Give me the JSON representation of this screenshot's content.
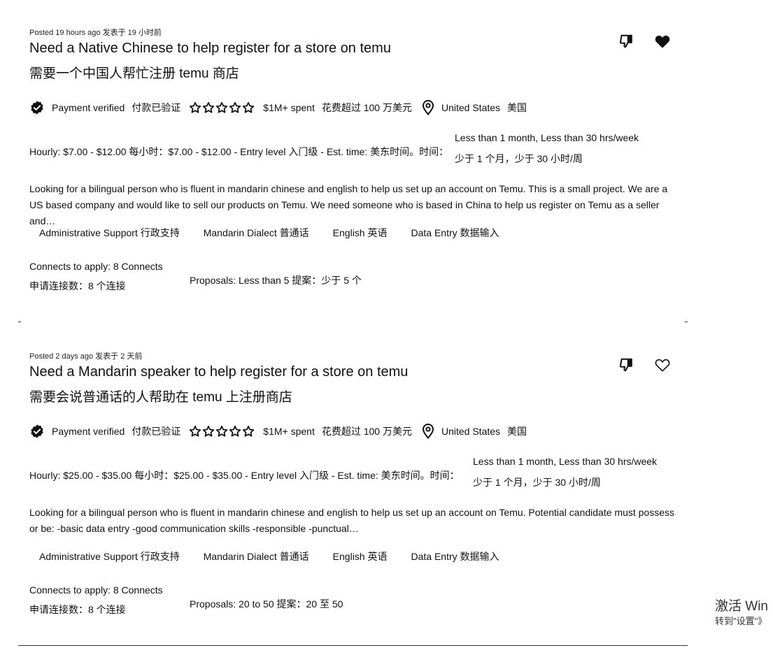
{
  "jobs": [
    {
      "posted": "Posted 19 hours ago 发表于 19 小时前",
      "title_en": "Need a Native Chinese to help register for a store on temu",
      "title_zh": "需要一个中国人帮忙注册 temu 商店",
      "payment_verified": "Payment verified",
      "payment_verified_zh": "付款已验证",
      "rating_stars": 5,
      "spent": "$1M+  spent",
      "spent_zh": "花费超过 100 万美元",
      "location": "United States",
      "location_zh": "美国",
      "hourly": "Hourly: $7.00 - $12.00  每小时：$7.00 - $12.00 - Entry level 入门级 - Est. time: 美东时间。时间：",
      "duration": "Less than 1 month, Less than 30 hrs/week",
      "duration_zh": "少于 1 个月，少于 30 小时/周",
      "description": "Looking for a bilingual person who is fluent in mandarin chinese and english to help us set up an account on Temu. This is a small project. We are a US based company and would like to sell our products on Temu. We need someone who is based in China to help us register on Temu as a seller and…",
      "skills": [
        "Administrative Support   行政支持",
        "Mandarin Dialect   普通话",
        "English   英语",
        "Data Entry   数据输入"
      ],
      "connects": "Connects to apply:  8 Connects",
      "connects_zh": "申请连接数：8 个连接",
      "proposals": "Proposals:  Less than 5 提案：少于 5 个",
      "saved": true
    },
    {
      "posted": "Posted 2 days ago 发表于 2 天前",
      "title_en": "Need a Mandarin speaker to help register for a store on temu",
      "title_zh": "需要会说普通话的人帮助在 temu 上注册商店",
      "payment_verified": "Payment verified",
      "payment_verified_zh": "付款已验证",
      "rating_stars": 5,
      "spent": "$1M+  spent",
      "spent_zh": "花费超过 100 万美元",
      "location": "United States",
      "location_zh": "美国",
      "hourly": "Hourly: $25.00 - $35.00  每小时：$25.00 - $35.00 - Entry level 入门级 - Est. time: 美东时间。时间：",
      "duration": "Less than 1 month, Less than 30 hrs/week",
      "duration_zh": "少于 1 个月，少于 30 小时/周",
      "description": "Looking for a bilingual person who is fluent in mandarin chinese and english to help us set up an account on Temu. Potential candidate must possess or be: -basic data entry -good communication skills -responsible -punctual…",
      "skills": [
        "Administrative Support   行政支持",
        "Mandarin Dialect   普通话",
        "English   英语",
        "Data Entry   数据输入"
      ],
      "connects": "Connects to apply:  8 Connects",
      "connects_zh": "申请连接数：8 个连接",
      "proposals": "Proposals:  20 to 50 提案：20 至 50",
      "saved": false
    }
  ],
  "icons": {
    "dislike": "thumbs-down-icon",
    "save": "heart-icon",
    "verified": "verified-badge-icon",
    "star": "star-icon",
    "location": "location-pin-icon"
  },
  "watermark": {
    "line1": "激活 Win",
    "line2": "转到\"设置\"》"
  }
}
